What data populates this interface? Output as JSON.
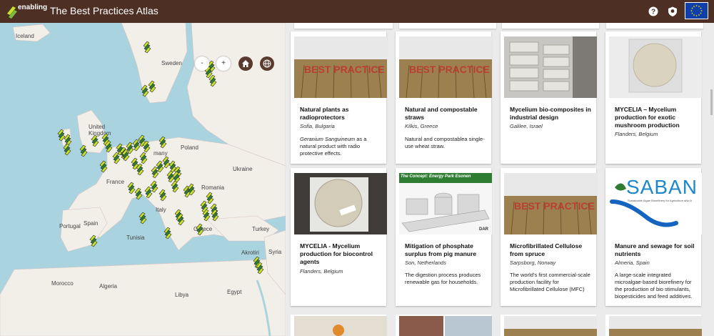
{
  "header": {
    "logo_text": "enabling",
    "title": "The Best Practices Atlas"
  },
  "map": {
    "labels": [
      "Iceland",
      "Sweden",
      "United Kingdom",
      "Poland",
      "Ukraine",
      "France",
      "Romania",
      "Portugal",
      "Spain",
      "Italy",
      "Turkey",
      "Greece",
      "Akrotiri",
      "Syria",
      "Tunisia",
      "Morocco",
      "Algeria",
      "Libya",
      "Egypt",
      "many"
    ],
    "controls": {
      "zoom_out": "-",
      "zoom_in": "+"
    },
    "info": "i"
  },
  "cards": [
    {
      "title": "Natural plants as radioprotectors",
      "location": "Sofia, Bulgaria",
      "desc_em": "Geranium Sanguineum",
      "desc": "as a natural product with radio protective effects.",
      "thumb_text": "BEST PRACTICE"
    },
    {
      "title": "Natural and compostable straws",
      "location": "Kilkis, Greece",
      "desc": "Natural and compostablea single-use wheat straw.",
      "thumb_text": "BEST PRACTICE"
    },
    {
      "title": "Mycelium bio-composites in industrial design",
      "location": "Galilee, Israel",
      "desc": ""
    },
    {
      "title": "MYCELIA – Mycelium production for exotic mushroom production",
      "location": "Flanders, Belgium",
      "desc": ""
    },
    {
      "title": "MYCELIA - Mycelium production for biocontrol agents",
      "location": "Flanders, Belgium",
      "desc": ""
    },
    {
      "title": "Mitigation of phosphate surplus from pig manure",
      "location": "Son, Netherlands",
      "desc": "The digestion process produces renewable gas for households.",
      "thumb_text": "The Concept: Energy Park Esonen",
      "thumb_brand": "DAR"
    },
    {
      "title": "Microfibrillated Cellulose from spruce",
      "location": "Sarpsborg, Norway",
      "desc": "The world’s first commercial-scale production facility for Microfibrillated Cellulose (MFC)",
      "thumb_text": "BEST PRACTICE"
    },
    {
      "title": "Manure and sewage for soil nutrients",
      "location": "Almeria, Spain",
      "desc": "A large-scale integrated microalgae-based biorefinery for the production of bio stimulants, biopesticides and feed additives.",
      "thumb_text": "SABAN",
      "thumb_sub": "Sustainable Algae Biorefinery for Agriculture aNd A"
    }
  ],
  "colors": {
    "header": "#4d2f24",
    "accent_green": "#8bc34a",
    "map_water": "#a9d3df",
    "land": "#f2efe9"
  }
}
